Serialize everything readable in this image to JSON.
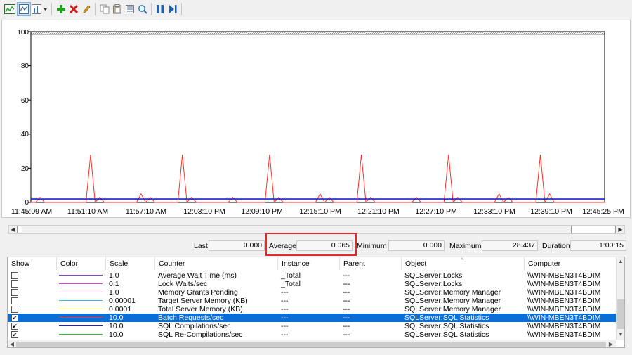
{
  "toolbar": {
    "buttons": [
      {
        "id": "view-graph",
        "icon": "graph-view-icon"
      },
      {
        "id": "view-histogram",
        "icon": "histogram-icon",
        "pressed": true
      },
      {
        "id": "change-graph-type",
        "icon": "graph-type-icon"
      },
      {
        "id": "add-counter",
        "icon": "add-icon",
        "color": "#22a020"
      },
      {
        "id": "delete-counter",
        "icon": "delete-icon",
        "color": "#d21a1a"
      },
      {
        "id": "highlight",
        "icon": "highlight-icon",
        "color": "#d4a017"
      },
      {
        "id": "copy-properties",
        "icon": "copy-icon"
      },
      {
        "id": "paste-counter-list",
        "icon": "paste-icon"
      },
      {
        "id": "properties",
        "icon": "properties-icon"
      },
      {
        "id": "zoom",
        "icon": "zoom-icon"
      },
      {
        "id": "freeze-display",
        "icon": "pause-icon",
        "color": "#1f5fb8"
      },
      {
        "id": "update-data",
        "icon": "step-icon",
        "color": "#1f5fb8"
      }
    ]
  },
  "graph": {
    "y_ticks": [
      "100",
      "80",
      "60",
      "40",
      "20",
      "0"
    ],
    "x_ticks": [
      "11:45:09 AM",
      "11:51:10 AM",
      "11:57:10 AM",
      "12:03:10 PM",
      "12:09:10 PM",
      "12:15:10 PM",
      "12:21:10 PM",
      "12:27:10 PM",
      "12:33:10 PM",
      "12:39:10 PM",
      "12:45:25 PM"
    ],
    "series_colors": {
      "batch": "#ff3030",
      "blue": "#1f1fd0"
    }
  },
  "chart_data": {
    "type": "line",
    "ylim": [
      0,
      100
    ],
    "series": [
      {
        "color": "#ff3030",
        "values": [
          0,
          0,
          3,
          0,
          0,
          0,
          0,
          0,
          0,
          0,
          0,
          0,
          0,
          28,
          0,
          3,
          0,
          0,
          0,
          0,
          0,
          0,
          0,
          0,
          5,
          0,
          3,
          0,
          0,
          0,
          0,
          0,
          0,
          28,
          0,
          3,
          0,
          0,
          0,
          0,
          0,
          0,
          0,
          0,
          3,
          0,
          0,
          0,
          0,
          0,
          0,
          0,
          28,
          0,
          3,
          0,
          0,
          0,
          0,
          0,
          0,
          0,
          0,
          5,
          0,
          3,
          0,
          0,
          0,
          0,
          0,
          0,
          28,
          0,
          3,
          0,
          0,
          0,
          0,
          0,
          0,
          0,
          0,
          0,
          3,
          0,
          0,
          0,
          0,
          0,
          0,
          28,
          0,
          3,
          0,
          0,
          0,
          0,
          0,
          0,
          0,
          0,
          5,
          0,
          3,
          0,
          0,
          0,
          0,
          0,
          0,
          28,
          0,
          5,
          0,
          0,
          0,
          0,
          0,
          0,
          0,
          0,
          0,
          0,
          0,
          0
        ]
      },
      {
        "color": "#1f1fd0",
        "values": [
          2,
          2,
          2,
          2,
          2,
          2,
          2,
          2,
          2,
          2,
          2,
          2,
          2,
          2,
          2,
          2,
          2,
          2,
          2,
          2,
          2,
          2,
          2,
          2,
          2,
          2,
          2,
          2,
          2,
          2,
          2,
          2,
          2,
          2,
          2,
          2,
          2,
          2,
          2,
          2,
          2,
          2,
          2,
          2,
          2,
          2,
          2,
          2,
          2,
          2,
          2,
          2,
          2,
          2,
          2,
          2,
          2,
          2,
          2,
          2,
          2,
          2,
          2,
          2,
          2,
          2,
          2,
          2,
          2,
          2,
          2,
          2,
          2,
          2,
          2,
          2,
          2,
          2,
          2,
          2,
          2,
          2,
          2,
          2,
          2,
          2,
          2,
          2,
          2,
          2,
          2,
          2,
          2,
          2,
          2,
          2,
          2,
          2,
          2,
          2,
          2,
          2,
          2,
          2,
          2,
          2,
          2,
          2,
          2,
          2,
          2,
          2,
          2,
          2,
          2,
          2,
          2,
          2,
          2,
          2,
          2,
          2,
          2
        ]
      }
    ]
  },
  "stats": {
    "last_label": "Last",
    "last_value": "0.000",
    "average_label": "Average",
    "average_value": "0.065",
    "minimum_label": "Minimum",
    "minimum_value": "0.000",
    "maximum_label": "Maximum",
    "maximum_value": "28.437",
    "duration_label": "Duration",
    "duration_value": "1:00:15"
  },
  "list": {
    "headers": [
      "Show",
      "Color",
      "Scale",
      "Counter",
      "Instance",
      "Parent",
      "Object",
      "Computer"
    ],
    "rows": [
      {
        "checked": false,
        "color": "#9040c0",
        "scale": "1.0",
        "counter": "Average Wait Time (ms)",
        "instance": "_Total",
        "parent": "---",
        "object": "SQLServer:Locks",
        "computer": "\\\\WIN-MBEN3T4BDIM"
      },
      {
        "checked": false,
        "color": "#e040e0",
        "scale": "0.1",
        "counter": "Lock Waits/sec",
        "instance": "_Total",
        "parent": "---",
        "object": "SQLServer:Locks",
        "computer": "\\\\WIN-MBEN3T4BDIM"
      },
      {
        "checked": false,
        "color": "#d8a0d8",
        "scale": "1.0",
        "counter": "Memory Grants Pending",
        "instance": "---",
        "parent": "---",
        "object": "SQLServer:Memory Manager",
        "computer": "\\\\WIN-MBEN3T4BDIM"
      },
      {
        "checked": false,
        "color": "#40b0e0",
        "scale": "0.00001",
        "counter": "Target Server Memory (KB)",
        "instance": "---",
        "parent": "---",
        "object": "SQLServer:Memory Manager",
        "computer": "\\\\WIN-MBEN3T4BDIM"
      },
      {
        "checked": false,
        "color": "#e8e040",
        "scale": "0.0001",
        "counter": "Total Server Memory (KB)",
        "instance": "---",
        "parent": "---",
        "object": "SQLServer:Memory Manager",
        "computer": "\\\\WIN-MBEN3T4BDIM"
      },
      {
        "checked": true,
        "selected": true,
        "color": "#ff3030",
        "scale": "10.0",
        "counter": "Batch Requests/sec",
        "instance": "---",
        "parent": "---",
        "object": "SQLServer:SQL Statistics",
        "computer": "\\\\WIN-MBEN3T4BDIM"
      },
      {
        "checked": true,
        "color": "#1f1fd0",
        "scale": "10.0",
        "counter": "SQL Compilations/sec",
        "instance": "---",
        "parent": "---",
        "object": "SQLServer:SQL Statistics",
        "computer": "\\\\WIN-MBEN3T4BDIM"
      },
      {
        "checked": true,
        "color": "#30c030",
        "scale": "10.0",
        "counter": "SQL Re-Compilations/sec",
        "instance": "---",
        "parent": "---",
        "object": "SQLServer:SQL Statistics",
        "computer": "\\\\WIN-MBEN3T4BDIM"
      }
    ]
  }
}
